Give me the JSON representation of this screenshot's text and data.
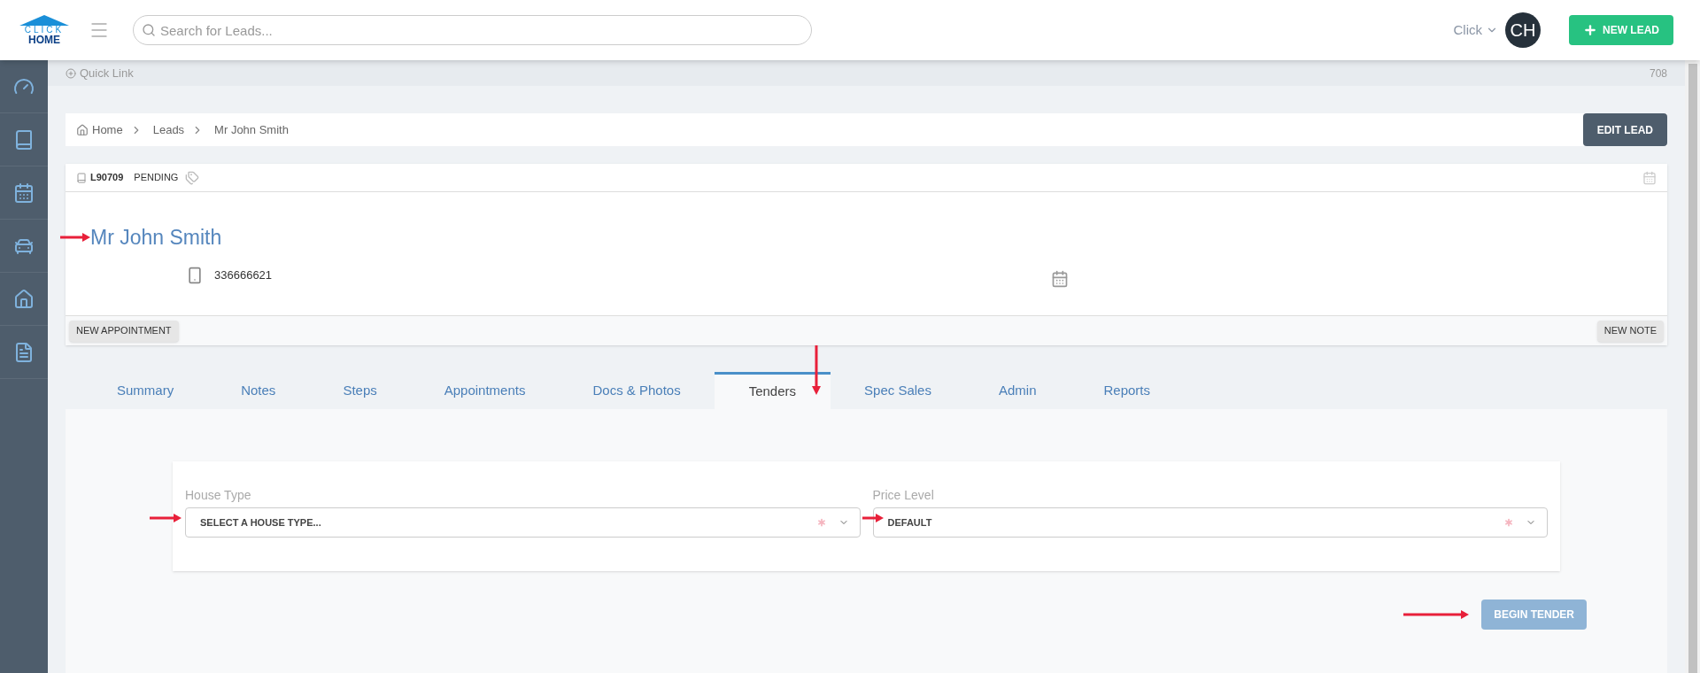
{
  "header": {
    "logo": {
      "top": "CLICK",
      "bottom": "HOME"
    },
    "search": {
      "placeholder": "Search for Leads..."
    },
    "user": {
      "name": "Click",
      "initials": "CH"
    },
    "new_lead_button": "NEW LEAD"
  },
  "sidebar": {
    "items": [
      {
        "kind": "gauge",
        "selected": false
      },
      {
        "kind": "book",
        "selected": false
      },
      {
        "kind": "calendar",
        "selected": false
      },
      {
        "kind": "car",
        "selected": false
      },
      {
        "kind": "home",
        "selected": false
      },
      {
        "kind": "file",
        "selected": false
      }
    ]
  },
  "quick_link": {
    "label": "Quick Link",
    "count": "708"
  },
  "breadcrumb": [
    "Home",
    "Leads",
    "Mr John Smith"
  ],
  "edit_lead_button": "EDIT LEAD",
  "lead": {
    "id": "L90709",
    "status": "PENDING",
    "name": "Mr John Smith",
    "phone": "336666621",
    "buttons": [
      "NEW APPOINTMENT",
      "NEW NOTE"
    ]
  },
  "tabs": [
    {
      "label": "Summary",
      "selected": false
    },
    {
      "label": "Notes",
      "selected": false
    },
    {
      "label": "Steps",
      "selected": false
    },
    {
      "label": "Appointments",
      "selected": false
    },
    {
      "label": "Docs & Photos",
      "selected": false
    },
    {
      "label": "Tenders",
      "selected": true
    },
    {
      "label": "Spec Sales",
      "selected": false
    },
    {
      "label": "Admin",
      "selected": false
    },
    {
      "label": "Reports",
      "selected": false
    }
  ],
  "tender_form": {
    "fields": [
      {
        "label": "House Type",
        "value": "SELECT A HOUSE TYPE...",
        "required": true
      },
      {
        "label": "Price Level",
        "value": "DEFAULT",
        "required": true
      }
    ],
    "begin_button": {
      "label": "BEGIN TENDER",
      "disabled": true
    }
  }
}
